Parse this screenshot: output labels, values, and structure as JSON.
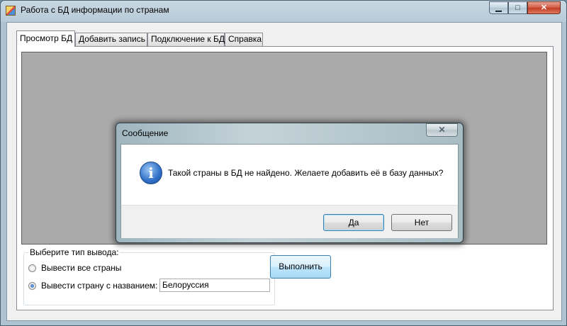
{
  "window": {
    "title": "Работа с БД информации по странам",
    "controls": {
      "minimize": "▁",
      "maximize": "□",
      "close": "✕"
    }
  },
  "tabs": [
    {
      "label": "Просмотр БД",
      "active": true
    },
    {
      "label": "Добавить запись",
      "active": false
    },
    {
      "label": "Подключение к БД",
      "active": false
    },
    {
      "label": "Справка",
      "active": false
    }
  ],
  "output_group": {
    "legend": "Выберите тип вывода:",
    "options": [
      {
        "label": "Вывести все страны",
        "checked": false
      },
      {
        "label": "Вывести страну с названием:",
        "checked": true
      }
    ],
    "country_value": "Белоруссия"
  },
  "run_button": "Выполнить",
  "dialog": {
    "title": "Сообщение",
    "close": "✕",
    "icon": "information-icon",
    "message": "Такой страны в БД не найдено. Желаете добавить её в базу данных?",
    "yes": "Да",
    "no": "Нет"
  }
}
